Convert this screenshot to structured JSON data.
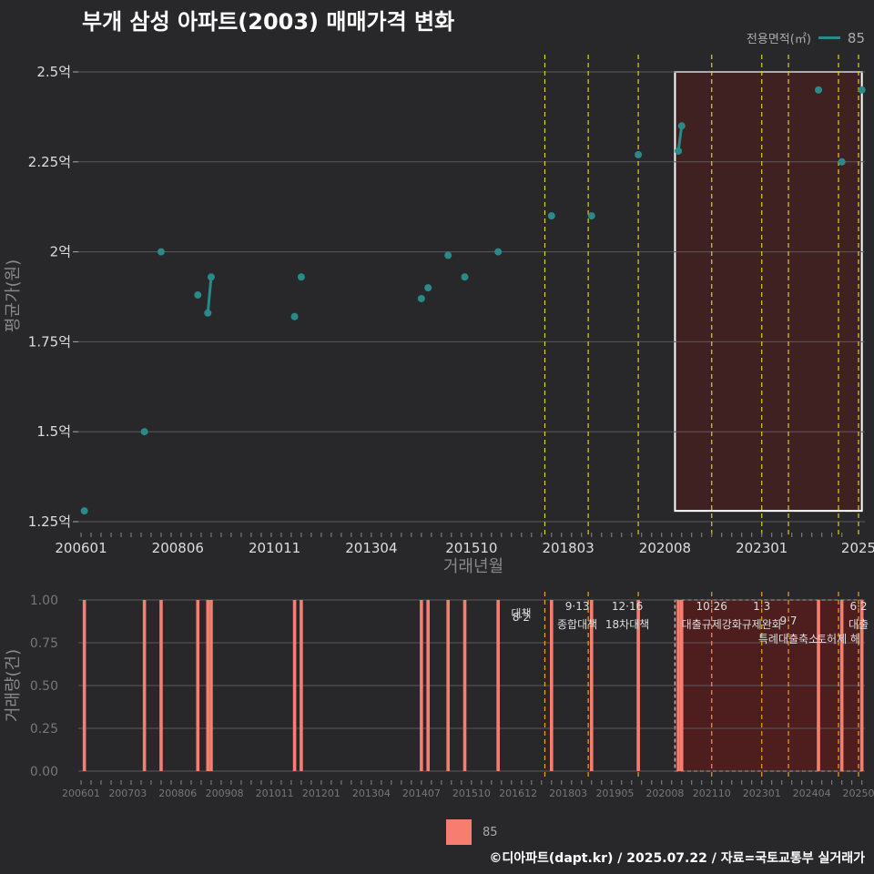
{
  "title": "부개 삼성 아파트(2003) 매매가격 변화",
  "legend_top": {
    "label": "전용면적(㎡)",
    "value": "85",
    "color": "#2a8a8a"
  },
  "legend_bottom": {
    "value": "85",
    "color": "#f87d71"
  },
  "footer": "©디아파트(dapt.kr) / 2025.07.22 / 자료=국토교통부 실거래가",
  "chart_data": [
    {
      "type": "line",
      "ylabel": "평균가(원)",
      "xlabel": "거래년월",
      "ylim": [
        1.22,
        2.57
      ],
      "yticks": [
        1.25,
        1.5,
        1.75,
        2.0,
        2.25,
        2.5
      ],
      "ytick_labels": [
        "1.25억",
        "1.5억",
        "1.75억",
        "2억",
        "2.25억",
        "2.5억"
      ],
      "xlim": [
        "2005-12",
        "2025-08"
      ],
      "xticks": [
        "2006-01",
        "2008-06",
        "2010-11",
        "2013-04",
        "2015-10",
        "2018-03",
        "2020-08",
        "2023-01",
        "2025-06"
      ],
      "xtick_labels": [
        "200601",
        "200806",
        "201011",
        "201304",
        "201510",
        "201803",
        "202008",
        "202301",
        "2025"
      ],
      "highlight_box": {
        "x": [
          "2020-11",
          "2025-07"
        ],
        "y": [
          1.28,
          2.5
        ]
      },
      "policy_lines": [
        "2017-08",
        "2018-09",
        "2019-12",
        "2021-10",
        "2023-01",
        "2023-09",
        "2024-12",
        "2025-06"
      ],
      "series": [
        {
          "name": "85",
          "points": [
            {
              "x": "2006-02",
              "y": 1.28
            },
            {
              "x": "2007-08",
              "y": 1.5
            },
            {
              "x": "2008-01",
              "y": 2.0
            },
            {
              "x": "2008-12",
              "y": 1.88
            },
            {
              "x": "2009-03",
              "y": 1.83
            },
            {
              "x": "2009-04",
              "y": 1.93
            },
            {
              "x": "2011-05",
              "y": 1.82
            },
            {
              "x": "2011-07",
              "y": 1.93
            },
            {
              "x": "2014-07",
              "y": 1.87
            },
            {
              "x": "2014-09",
              "y": 1.9
            },
            {
              "x": "2015-03",
              "y": 1.99
            },
            {
              "x": "2015-08",
              "y": 1.93
            },
            {
              "x": "2016-06",
              "y": 2.0
            },
            {
              "x": "2017-10",
              "y": 2.1
            },
            {
              "x": "2018-10",
              "y": 2.1
            },
            {
              "x": "2019-12",
              "y": 2.27
            },
            {
              "x": "2020-12",
              "y": 2.28
            },
            {
              "x": "2021-01",
              "y": 2.35
            },
            {
              "x": "2024-06",
              "y": 2.45
            },
            {
              "x": "2025-01",
              "y": 2.25
            },
            {
              "x": "2025-07",
              "y": 2.45
            }
          ]
        }
      ]
    },
    {
      "type": "bar",
      "ylabel": "거래량(건)",
      "ylim": [
        0,
        1
      ],
      "yticks": [
        0,
        0.25,
        0.5,
        0.75,
        1.0
      ],
      "ytick_labels": [
        "0.00",
        "0.25",
        "0.50",
        "0.75",
        "1.00"
      ],
      "xticks": [
        "2006-01",
        "2007-03",
        "2008-06",
        "2009-08",
        "2010-11",
        "2012-01",
        "2013-04",
        "2014-07",
        "2015-10",
        "2016-12",
        "2018-03",
        "2019-05",
        "2020-08",
        "2021-10",
        "2023-01",
        "2024-04",
        "2025-06"
      ],
      "xtick_labels": [
        "200601",
        "200703",
        "200806",
        "200908",
        "201011",
        "201201",
        "201304",
        "201407",
        "201510",
        "201612",
        "201803",
        "201905",
        "202008",
        "202110",
        "202301",
        "202404",
        "20250"
      ],
      "bars": [
        {
          "x": "2006-02",
          "value": 1
        },
        {
          "x": "2007-08",
          "value": 1
        },
        {
          "x": "2008-01",
          "value": 1
        },
        {
          "x": "2008-12",
          "value": 1
        },
        {
          "x": "2009-03",
          "value": 1
        },
        {
          "x": "2009-04",
          "value": 1
        },
        {
          "x": "2011-05",
          "value": 1
        },
        {
          "x": "2011-07",
          "value": 1
        },
        {
          "x": "2014-07",
          "value": 1
        },
        {
          "x": "2014-09",
          "value": 1
        },
        {
          "x": "2015-03",
          "value": 1
        },
        {
          "x": "2015-08",
          "value": 1
        },
        {
          "x": "2016-06",
          "value": 1
        },
        {
          "x": "2017-10",
          "value": 1
        },
        {
          "x": "2018-10",
          "value": 1
        },
        {
          "x": "2019-12",
          "value": 1
        },
        {
          "x": "2020-12",
          "value": 1
        },
        {
          "x": "2021-01",
          "value": 1
        },
        {
          "x": "2024-06",
          "value": 1
        },
        {
          "x": "2025-01",
          "value": 1
        },
        {
          "x": "2025-07",
          "value": 1
        }
      ],
      "policy_annotations": [
        {
          "x": "2017-08",
          "date": "8·2",
          "label": "대책"
        },
        {
          "x": "2018-09",
          "date": "9·13",
          "label": "종합대책"
        },
        {
          "x": "2019-12",
          "date": "12·16",
          "label": "18차대책"
        },
        {
          "x": "2021-10",
          "date": "10·26",
          "label": "대출규제강화"
        },
        {
          "x": "2023-01",
          "date": "1·3",
          "label": "규제완화"
        },
        {
          "x": "2023-09",
          "date": "9·7",
          "label": "특례대출축소"
        },
        {
          "x": "2024-12",
          "date": "",
          "label": "토허제 해"
        },
        {
          "x": "2025-06",
          "date": "6·2",
          "label": "대출"
        }
      ]
    }
  ]
}
